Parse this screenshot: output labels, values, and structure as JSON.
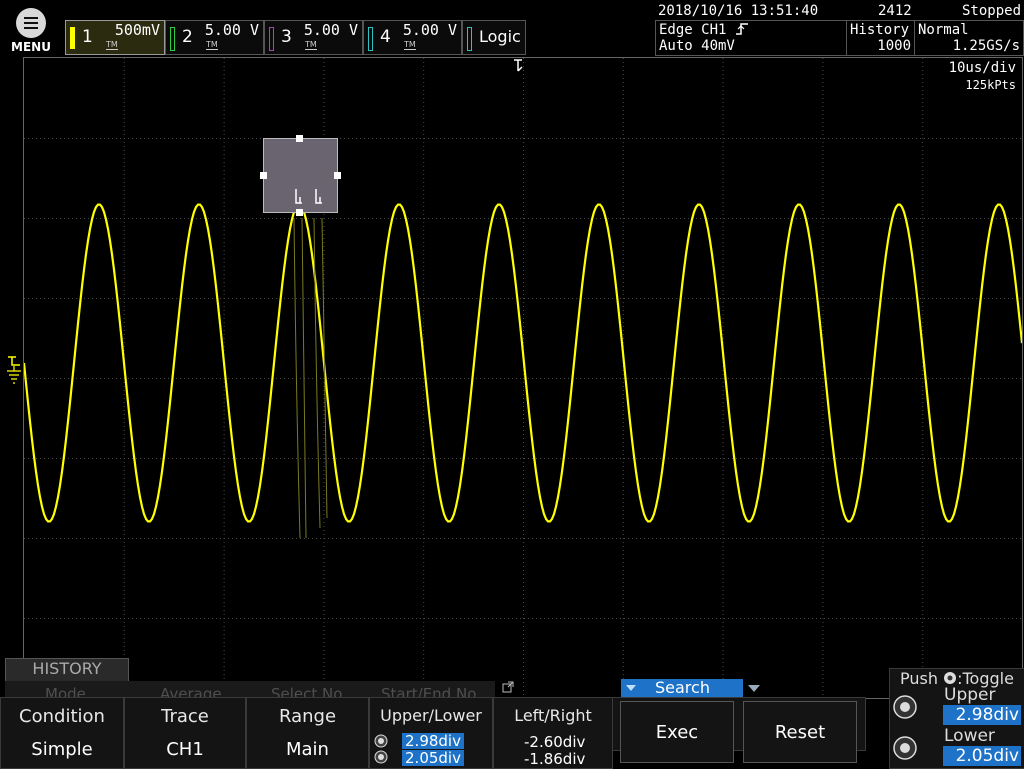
{
  "menu": {
    "label": "MENU"
  },
  "channels": [
    {
      "num": "1",
      "value": "500mV",
      "coupling": "TM",
      "color": "#ffff00"
    },
    {
      "num": "2",
      "value": "5.00 V",
      "coupling": "TM",
      "color": "#2ecc40"
    },
    {
      "num": "3",
      "value": "5.00 V",
      "coupling": "TM",
      "color": "#b040c0"
    },
    {
      "num": "4",
      "value": "5.00 V",
      "coupling": "TM",
      "color": "#30c0c0"
    }
  ],
  "logic": {
    "label": "Logic"
  },
  "status": {
    "datetime": "2018/10/16 13:51:40",
    "count": "2412",
    "state": "Stopped",
    "trigger_line1": "Edge CH1",
    "trigger_line2": "Auto 40mV",
    "history_label": "History",
    "history_value": "1000",
    "mode": "Normal",
    "sample_rate": "1.25GS/s"
  },
  "timebase": {
    "div": "10us/div",
    "points": "125kPts"
  },
  "waveform": {
    "color": "#ffff00",
    "cycles": 10,
    "amplitude_div": 3.2
  },
  "history_panel": {
    "title": "HISTORY",
    "dim_items": [
      "Mode",
      "Average",
      "Select No.",
      "Start/End No."
    ],
    "search_label": "Search"
  },
  "softkeys": {
    "condition": {
      "title": "Condition",
      "value": "Simple"
    },
    "trace": {
      "title": "Trace",
      "value": "CH1"
    },
    "range": {
      "title": "Range",
      "value": "Main"
    },
    "upper_lower": {
      "title": "Upper/Lower",
      "upper": "2.98div",
      "lower": "2.05div"
    },
    "left_right": {
      "title": "Left/Right",
      "left": "-2.60div",
      "right": "-1.86div"
    },
    "exec": "Exec",
    "reset": "Reset"
  },
  "side_panel": {
    "push_label": "Push",
    "toggle_label": ":Toggle",
    "upper_label": "Upper",
    "upper_value": "2.98div",
    "lower_label": "Lower",
    "lower_value": "2.05div"
  }
}
